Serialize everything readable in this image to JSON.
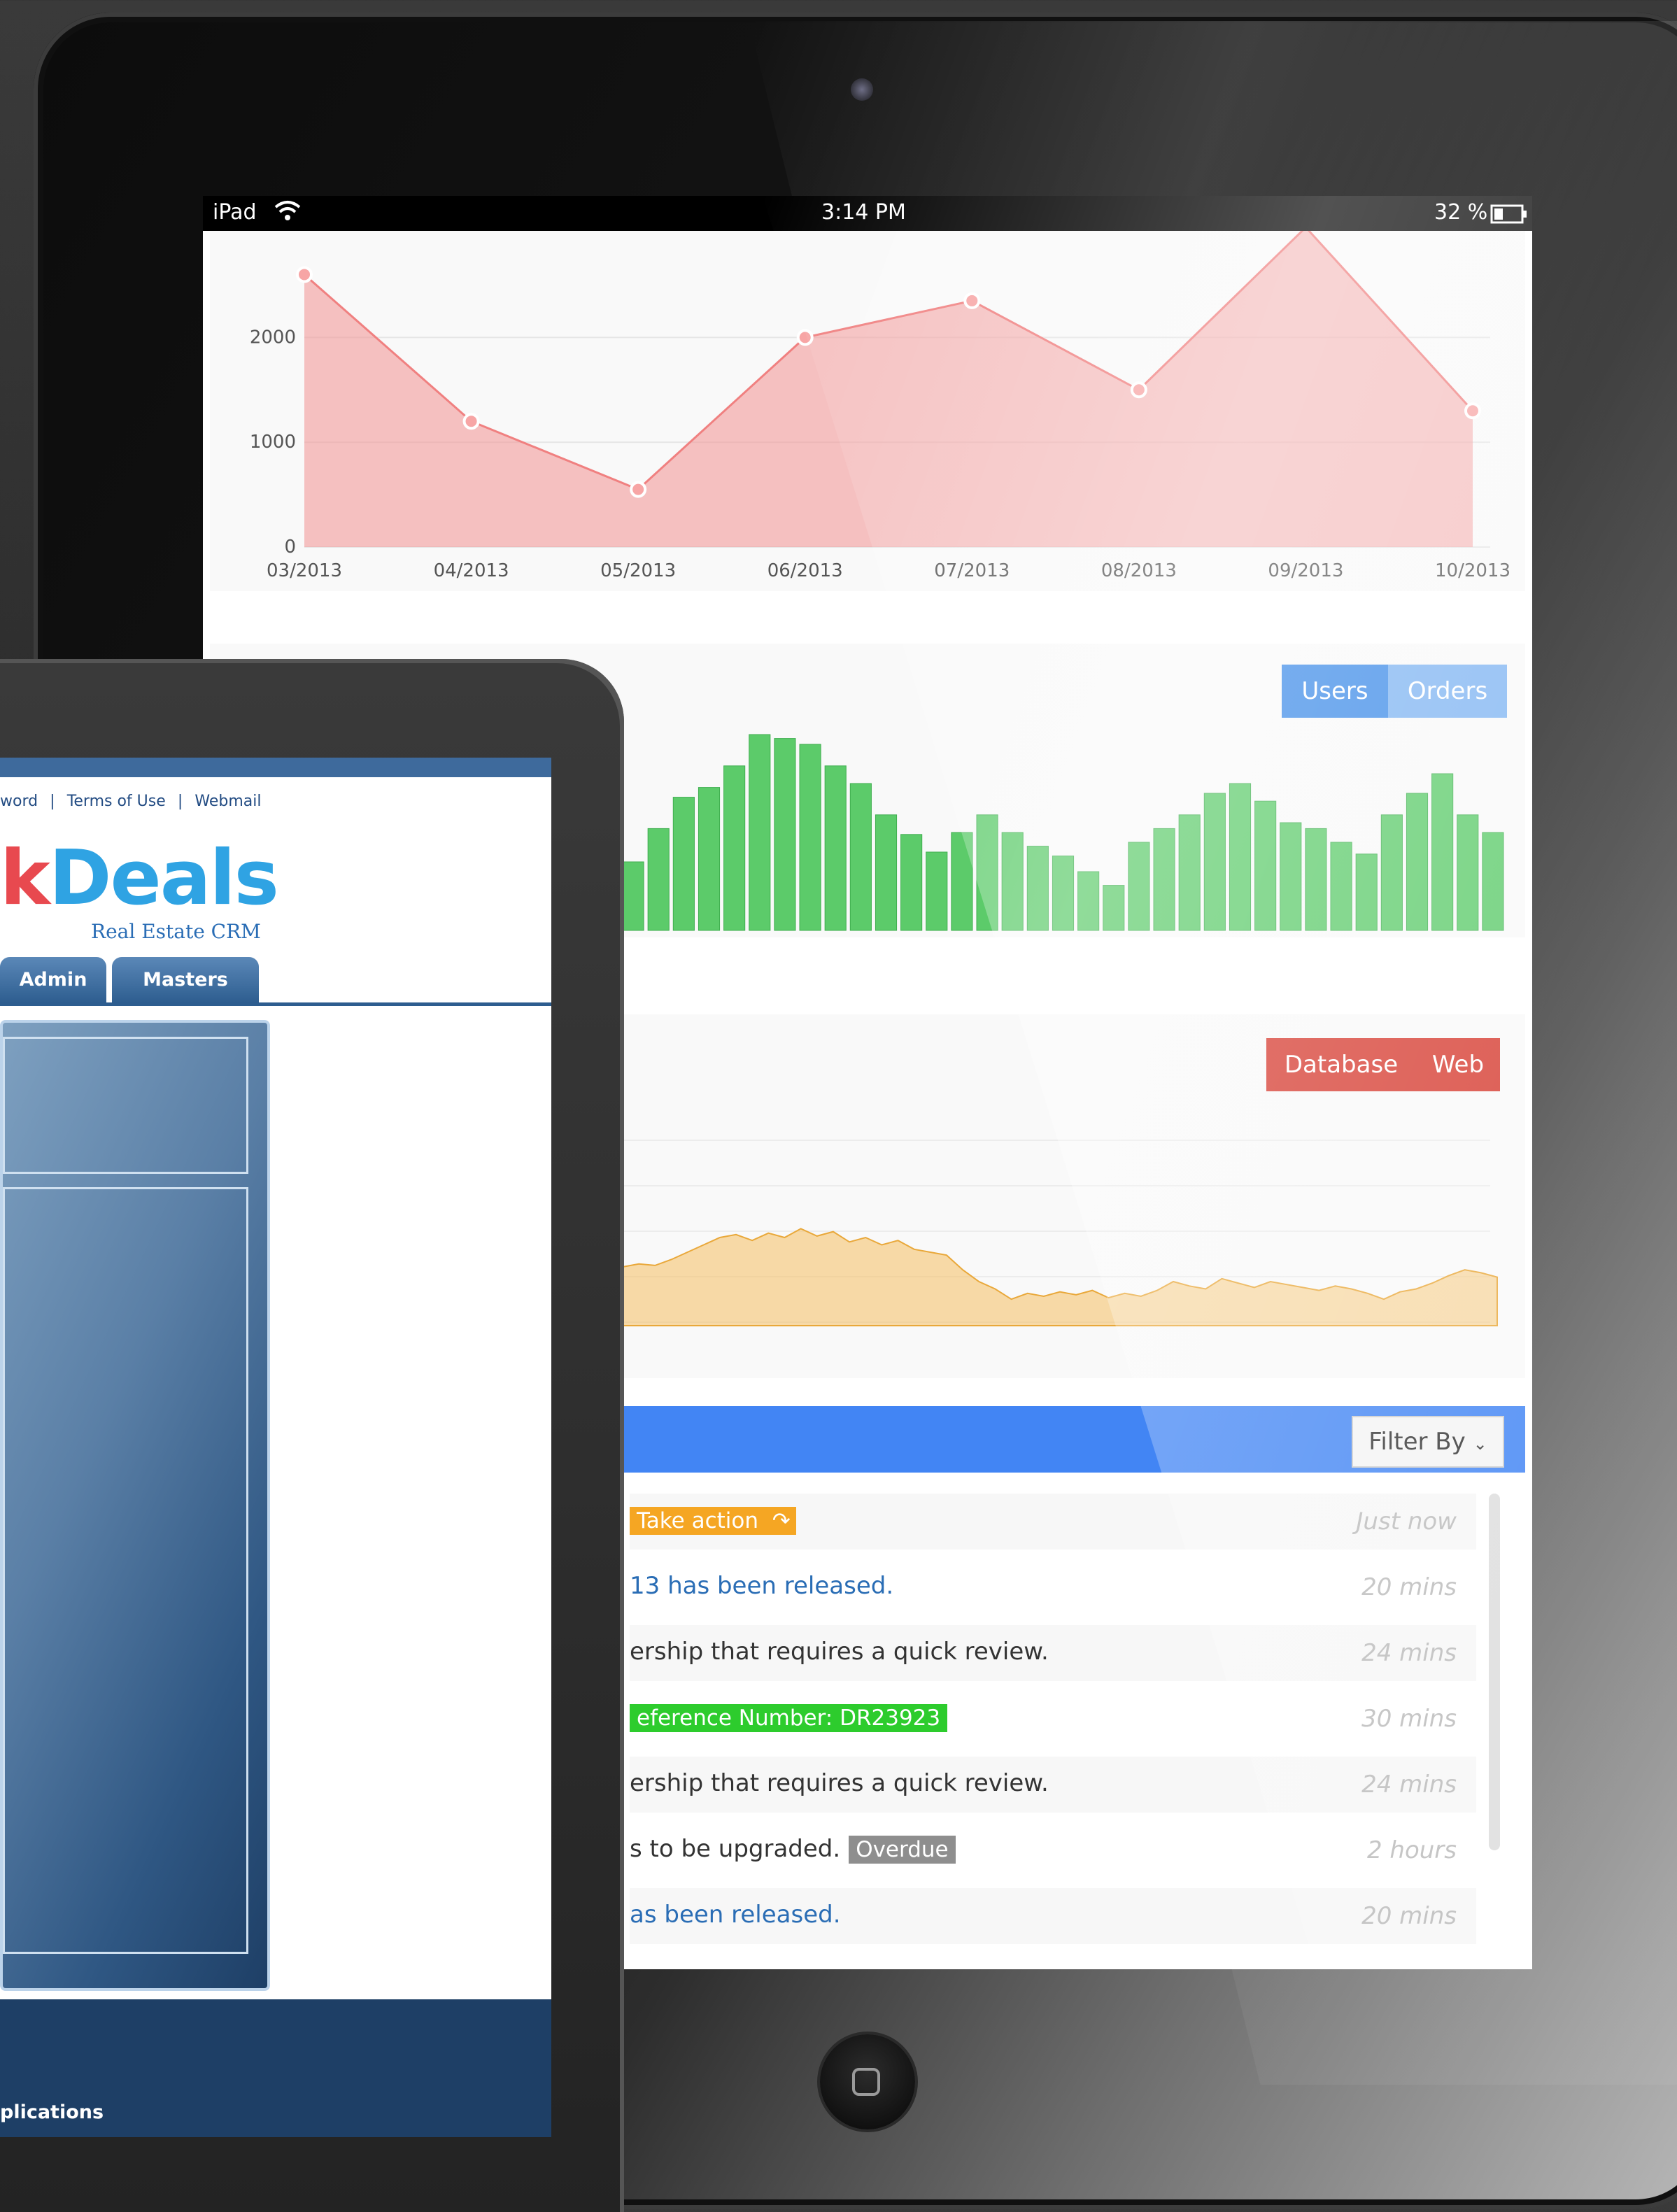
{
  "status_bar": {
    "device": "iPad",
    "time": "3:14 PM",
    "battery": "32 %"
  },
  "area_chart": {
    "chart_data": {
      "type": "area",
      "categories": [
        "03/2013",
        "04/2013",
        "05/2013",
        "06/2013",
        "07/2013",
        "08/2013",
        "09/2013",
        "10/2013"
      ],
      "values": [
        2600,
        1200,
        550,
        2000,
        2350,
        1500,
        3200,
        1300
      ],
      "y_ticks": [
        "0",
        "1000",
        "2000"
      ],
      "ylim": [
        0,
        2850
      ],
      "color": "#f29a9a"
    }
  },
  "bar_chart": {
    "buttons": {
      "users": "Users",
      "orders": "Orders"
    },
    "chart_data": {
      "type": "bar",
      "values": [
        35,
        52,
        68,
        73,
        84,
        100,
        98,
        95,
        84,
        75,
        59,
        49,
        40,
        50,
        59,
        50,
        43,
        38,
        30,
        23,
        45,
        52,
        59,
        70,
        75,
        66,
        55,
        52,
        45,
        39,
        59,
        70,
        80,
        59,
        50
      ],
      "color": "#5ccb6a"
    }
  },
  "line_chart": {
    "buttons": {
      "database": "Database",
      "web": "Web"
    },
    "chart_data": {
      "type": "area",
      "values": [
        40,
        42,
        41,
        45,
        50,
        55,
        60,
        62,
        58,
        63,
        60,
        66,
        61,
        64,
        57,
        60,
        55,
        58,
        52,
        50,
        48,
        38,
        30,
        25,
        18,
        22,
        20,
        23,
        21,
        24,
        19,
        22,
        20,
        24,
        30,
        27,
        25,
        32,
        29,
        26,
        30,
        28,
        26,
        24,
        27,
        25,
        22,
        18,
        23,
        25,
        29,
        34,
        38,
        36,
        33
      ],
      "color": "#f6c063"
    }
  },
  "activity": {
    "filter_label": "Filter By",
    "items": [
      {
        "text": "",
        "tag": "Take action",
        "tag_color": "#f5a623",
        "time": "Just now",
        "color": "#333333"
      },
      {
        "text": "13 has been released.",
        "tag": "",
        "time": "20 mins",
        "color": "#2a6db5"
      },
      {
        "text": "ership that requires a quick review.",
        "tag": "",
        "time": "24 mins",
        "color": "#333333"
      },
      {
        "text": "",
        "tag": "eference Number: DR23923",
        "tag_color": "#2dcc2d",
        "time": "30 mins",
        "color": "#333333"
      },
      {
        "text": "ership that requires a quick review.",
        "tag": "",
        "time": "24 mins",
        "color": "#333333"
      },
      {
        "text": "s to be upgraded.",
        "tag": "Overdue",
        "tag_color": "#8e8e8e",
        "time": "2 hours",
        "color": "#333333"
      },
      {
        "text": "as been released.",
        "tag": "",
        "time": "20 mins",
        "color": "#2a6db5"
      }
    ]
  },
  "left_app": {
    "top_links": [
      "word",
      "Terms of Use",
      "Webmail"
    ],
    "logo_text": "Deals",
    "logo_prefix": "k",
    "logo_sub": "Real Estate CRM",
    "tabs": [
      "Admin",
      "Masters"
    ],
    "footer_text": "plications"
  }
}
